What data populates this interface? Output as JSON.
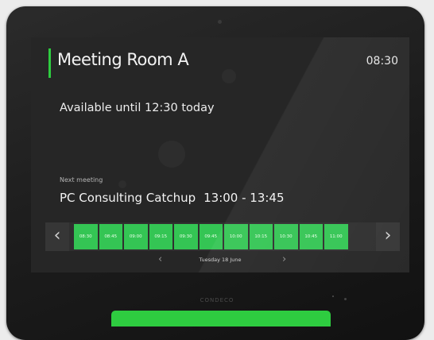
{
  "room": {
    "name": "Meeting Room A",
    "time": "08:30",
    "availability": "Available until 12:30 today"
  },
  "next_meeting": {
    "label": "Next meeting",
    "title": "PC Consulting Catchup",
    "time_range": "13:00 - 13:45"
  },
  "timeline": {
    "slots": [
      "08:30",
      "08:45",
      "09:00",
      "09:15",
      "09:30",
      "09:45",
      "10:00",
      "10:15",
      "10:30",
      "10:45",
      "11:00"
    ],
    "date_label": "Tuesday 18 June",
    "prev_icon": "chevron-left-icon",
    "next_icon": "chevron-right-icon"
  },
  "brand": "CONDECO",
  "colors": {
    "accent": "#2ecc40",
    "slot_free": "#34c554",
    "screen_bg": "#262626",
    "bezel": "#1b1b1b"
  }
}
